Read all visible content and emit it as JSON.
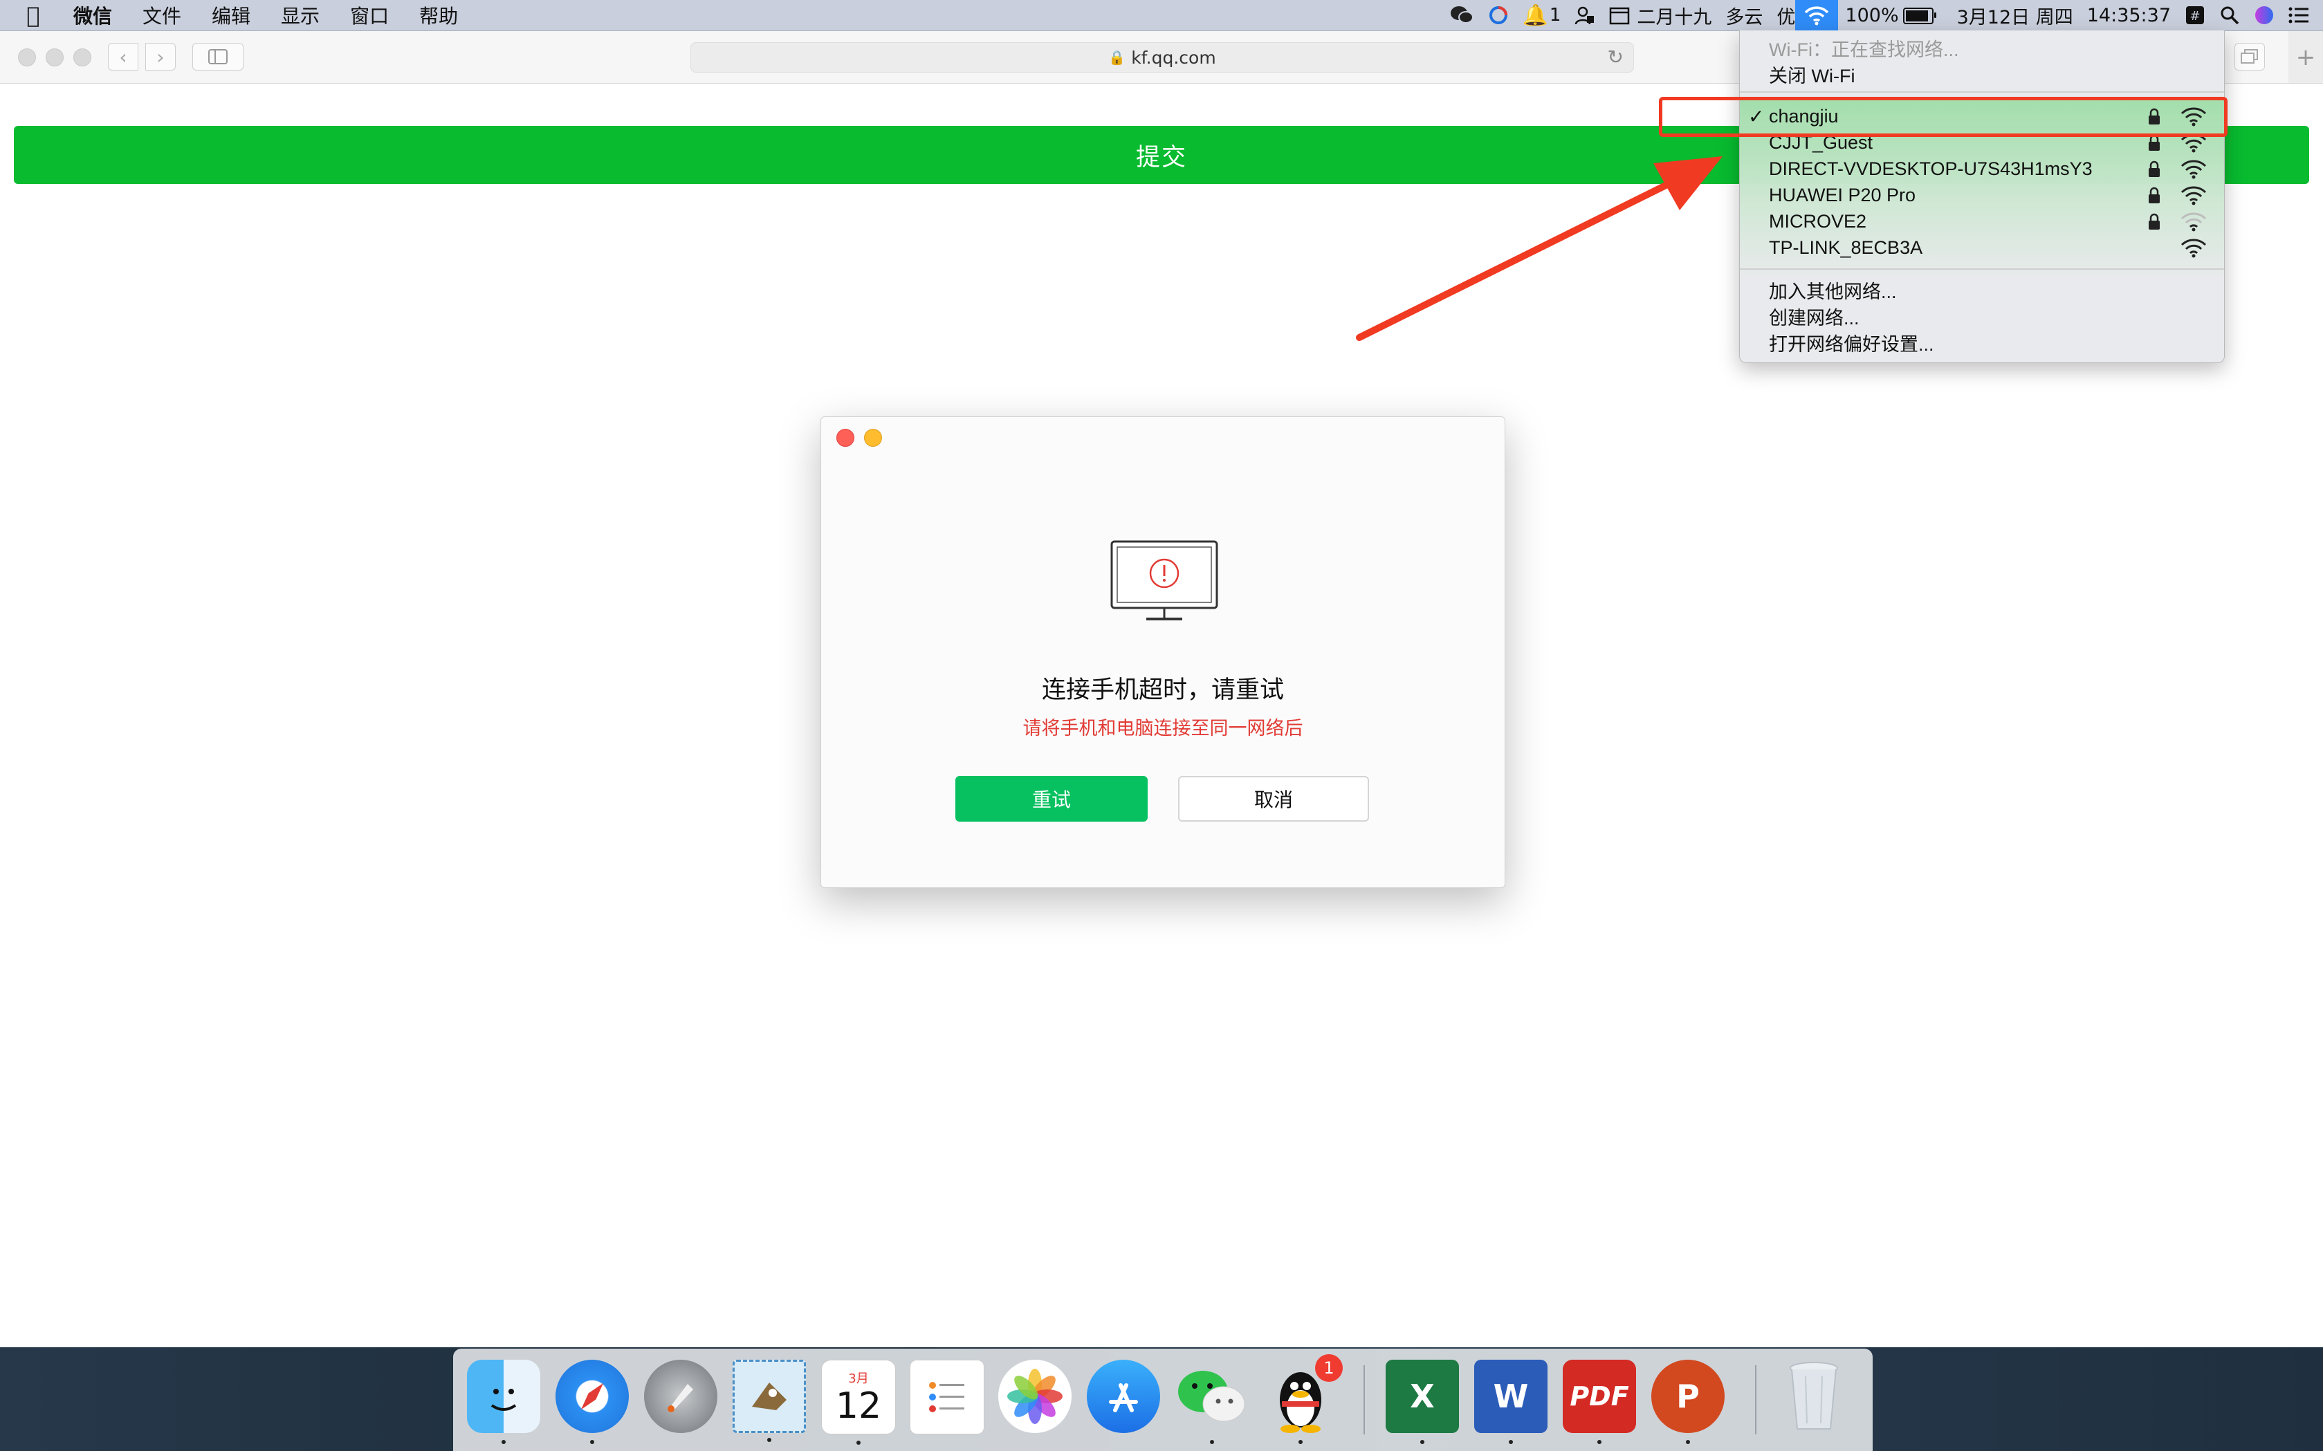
{
  "menubar": {
    "app_name": "微信",
    "menus": [
      "文件",
      "编辑",
      "显示",
      "窗口",
      "帮助"
    ],
    "notification_count": "1",
    "lunar_date": "二月十九",
    "weather": "多云",
    "air_quality": "优",
    "battery": "100%",
    "date": "3月12日 周四",
    "time": "14:35:37"
  },
  "browser": {
    "url": "kf.qq.com"
  },
  "page": {
    "submit_label": "提交"
  },
  "dialog": {
    "title": "连接手机超时，请重试",
    "subtitle": "请将手机和电脑连接至同一网络后",
    "retry_label": "重试",
    "cancel_label": "取消"
  },
  "wifi_menu": {
    "status": "Wi-Fi：正在查找网络...",
    "toggle_label": "关闭 Wi-Fi",
    "networks": [
      {
        "name": "changjiu",
        "connected": true,
        "locked": true,
        "signal": "full"
      },
      {
        "name": "CJJT_Guest",
        "connected": false,
        "locked": true,
        "signal": "full"
      },
      {
        "name": "DIRECT-VVDESKTOP-U7S43H1msY3",
        "connected": false,
        "locked": true,
        "signal": "full"
      },
      {
        "name": "HUAWEI P20 Pro",
        "connected": false,
        "locked": true,
        "signal": "full"
      },
      {
        "name": "MICROVE2",
        "connected": false,
        "locked": true,
        "signal": "weak"
      },
      {
        "name": "TP-LINK_8ECB3A",
        "connected": false,
        "locked": false,
        "signal": "full"
      }
    ],
    "join_other": "加入其他网络...",
    "create_network": "创建网络...",
    "open_prefs": "打开网络偏好设置..."
  },
  "dock": {
    "calendar_month": "3月",
    "calendar_day": "12",
    "qq_badge": "1",
    "apps": [
      "finder-icon",
      "safari-icon",
      "launchpad-icon",
      "mail-icon",
      "calendar-icon",
      "reminders-icon",
      "photos-icon",
      "app-store-icon",
      "wechat-icon",
      "qq-icon",
      "excel-icon",
      "word-icon",
      "pdf-icon",
      "powerpoint-icon",
      "trash-icon"
    ]
  },
  "colors": {
    "submit_green": "#08bb2f",
    "retry_green": "#07c160",
    "error_red": "#e23b35",
    "annotation_red": "#f03a22"
  }
}
